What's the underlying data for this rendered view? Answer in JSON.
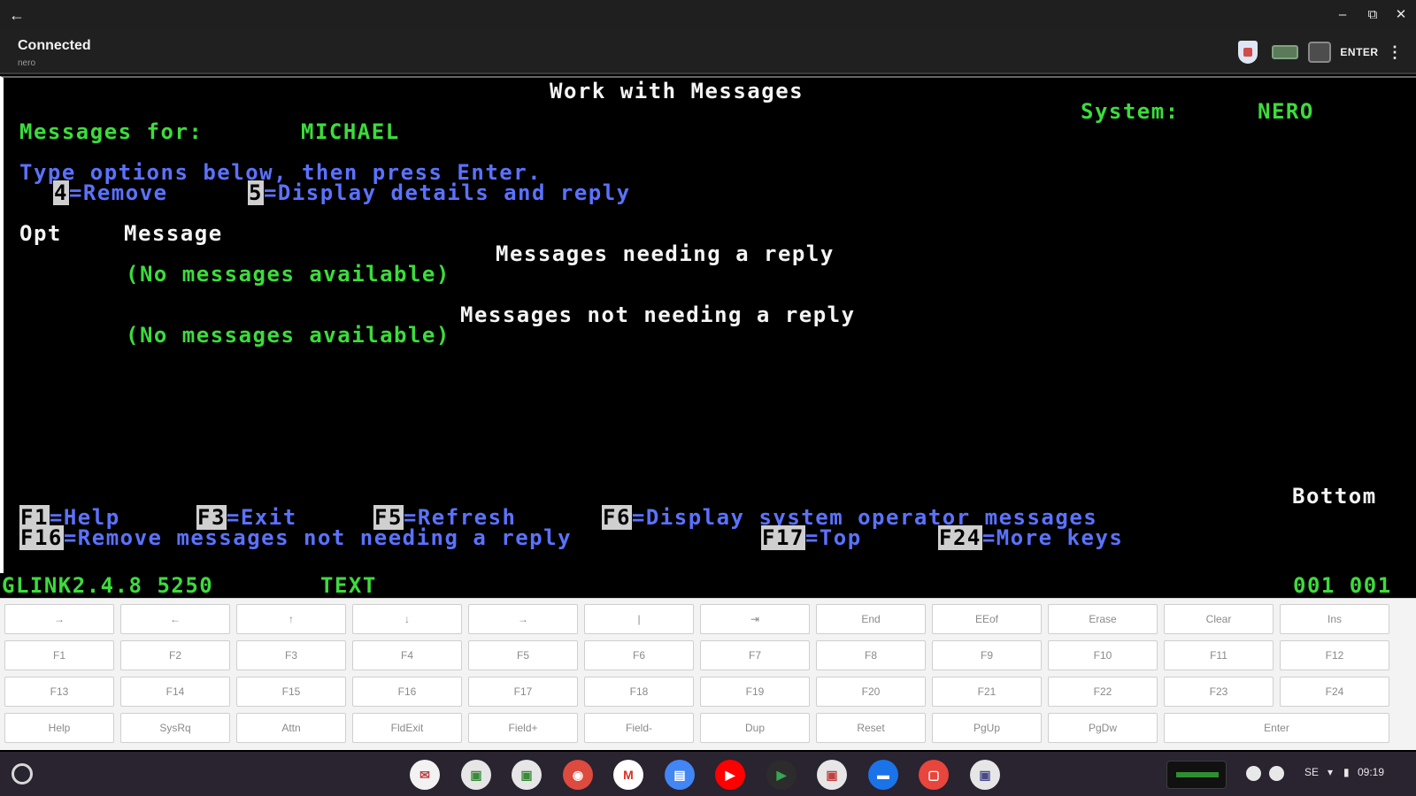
{
  "window": {
    "back_glyph": "←",
    "minimize_glyph": "–",
    "restore_glyph": "⧉",
    "close_glyph": "✕"
  },
  "app_bar": {
    "status": "Connected",
    "host": "nero",
    "enter_label": "ENTER",
    "menu_glyph": "⋮",
    "icons": [
      "badge-icon",
      "keyboard-icon",
      "lock-icon",
      "enter-icon",
      "more-vert-icon"
    ]
  },
  "terminal": {
    "title": "Work with Messages",
    "system_label": "System:",
    "system_name": "NERO",
    "messages_for_label": "Messages for:",
    "messages_for_user": "MICHAEL",
    "instructions": "Type options below, then press Enter.",
    "options": [
      {
        "key": "4",
        "text": "=Remove"
      },
      {
        "key": "5",
        "text": "=Display details and reply"
      }
    ],
    "col_opt": "Opt",
    "col_message": "Message",
    "section_reply": "Messages needing a reply",
    "section_reply_empty": "(No messages available)",
    "section_noreply": "Messages not needing a reply",
    "section_noreply_empty": "(No messages available)",
    "position": "Bottom",
    "fkeys_row1": [
      {
        "key": "F1",
        "text": "=Help"
      },
      {
        "key": "F3",
        "text": "=Exit"
      },
      {
        "key": "F5",
        "text": "=Refresh"
      },
      {
        "key": "F6",
        "text": "=Display system operator messages"
      }
    ],
    "fkeys_row2": [
      {
        "key": "F16",
        "text": "=Remove messages not needing a reply"
      },
      {
        "key": "F17",
        "text": "=Top"
      },
      {
        "key": "F24",
        "text": "=More keys"
      }
    ]
  },
  "status_line": {
    "emulator": "GLINK2.4.8 5250",
    "mode": "TEXT",
    "cursor": "001 001"
  },
  "keypad": {
    "row1": [
      "→",
      "←",
      "↑",
      "↓",
      "→",
      "|",
      "⇥",
      "End",
      "EEof",
      "Erase",
      "Clear",
      "Ins"
    ],
    "row2": [
      "F1",
      "F2",
      "F3",
      "F4",
      "F5",
      "F6",
      "F7",
      "F8",
      "F9",
      "F10",
      "F11",
      "F12"
    ],
    "row3": [
      "F13",
      "F14",
      "F15",
      "F16",
      "F17",
      "F18",
      "F19",
      "F20",
      "F21",
      "F22",
      "F23",
      "F24"
    ],
    "row4": [
      "Help",
      "SysRq",
      "Attn",
      "FldExit",
      "Field+",
      "Field-",
      "Dup",
      "Reset",
      "PgUp",
      "PgDw",
      "Enter"
    ]
  },
  "shelf": {
    "launcher_icon": "launcher-icon",
    "apps": [
      {
        "name": "mail-app-icon",
        "glyph": "✉",
        "color": "#f2f2f2",
        "fg": "#c04040"
      },
      {
        "name": "terminal-app-icon-1",
        "glyph": "▣",
        "color": "#e6e6e6",
        "fg": "#3a8a3a"
      },
      {
        "name": "terminal-app-icon-2",
        "glyph": "▣",
        "color": "#e6e6e6",
        "fg": "#3a8a3a"
      },
      {
        "name": "chrome-icon",
        "glyph": "◉",
        "color": "#dd4b3e",
        "fg": "#ffffff"
      },
      {
        "name": "gmail-icon",
        "glyph": "M",
        "color": "#ffffff",
        "fg": "#d93025"
      },
      {
        "name": "docs-icon",
        "glyph": "▤",
        "color": "#4285f4",
        "fg": "#ffffff"
      },
      {
        "name": "youtube-icon",
        "glyph": "▶",
        "color": "#ff0000",
        "fg": "#ffffff"
      },
      {
        "name": "play-store-icon",
        "glyph": "▶",
        "color": "#2c2c2c",
        "fg": "#34a853"
      },
      {
        "name": "terminal-app-icon-3",
        "glyph": "▣",
        "color": "#e6e6e6",
        "fg": "#c04040"
      },
      {
        "name": "files-icon",
        "glyph": "▬",
        "color": "#1a73e8",
        "fg": "#ffffff"
      },
      {
        "name": "screenshot-app-icon",
        "glyph": "▢",
        "color": "#e8453c",
        "fg": "#ffffff"
      },
      {
        "name": "terminal-app-icon-4",
        "glyph": "▣",
        "color": "#e6e6e6",
        "fg": "#4a4a8a"
      }
    ],
    "tray": {
      "network": "SE",
      "time": "09:19"
    }
  },
  "colors": {
    "terminal_bg": "#000000",
    "terminal_green": "#3cdc3c",
    "terminal_blue": "#5b72ff",
    "terminal_white": "#f4f4f4",
    "highlight": "#cfcfcf",
    "shelf_bg": "#2a2330"
  }
}
